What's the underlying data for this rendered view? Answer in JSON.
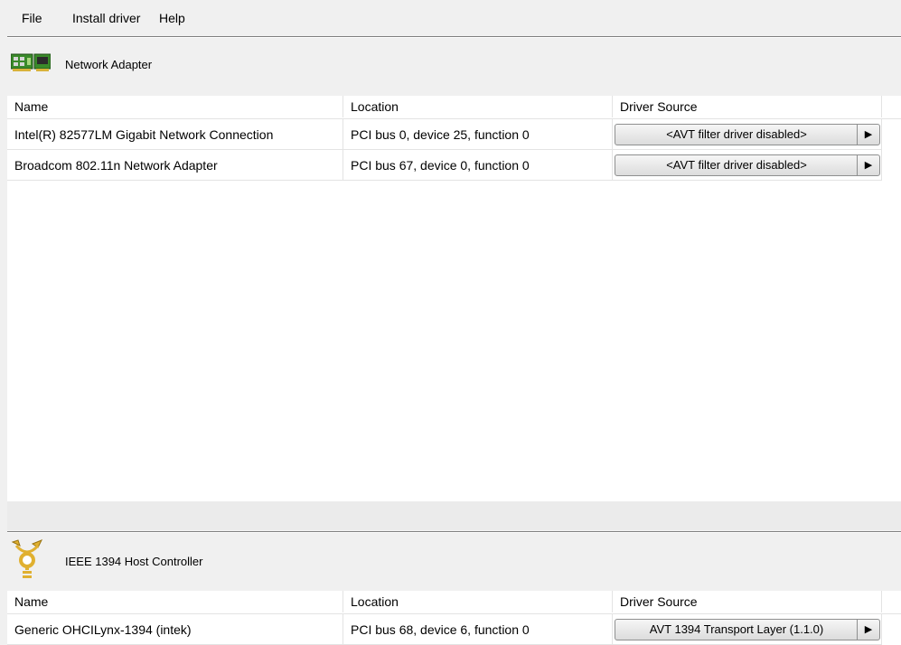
{
  "menu": {
    "file": "File",
    "install_driver": "Install driver",
    "help": "Help"
  },
  "network_section": {
    "title": "Network Adapter",
    "icon": "network-card-icon",
    "columns": {
      "name": "Name",
      "location": "Location",
      "driver_source": "Driver Source"
    },
    "rows": [
      {
        "name": "Intel(R) 82577LM Gigabit Network Connection",
        "location": "PCI bus 0, device 25, function 0",
        "driver_source": "<AVT filter driver disabled>"
      },
      {
        "name": "Broadcom 802.11n Network Adapter",
        "location": "PCI bus 67, device 0, function 0",
        "driver_source": "<AVT filter driver disabled>"
      }
    ]
  },
  "firewire_section": {
    "title": "IEEE 1394 Host Controller",
    "icon": "firewire-icon",
    "columns": {
      "name": "Name",
      "location": "Location",
      "driver_source": "Driver Source"
    },
    "rows": [
      {
        "name": "Generic OHCILynx-1394 (intek)",
        "location": "PCI bus 68, device 6, function 0",
        "driver_source": "AVT 1394 Transport Layer (1.1.0)"
      }
    ]
  },
  "colors": {
    "background": "#f0f0f0",
    "table": "#ffffff",
    "grid": "#e3e3e3"
  }
}
